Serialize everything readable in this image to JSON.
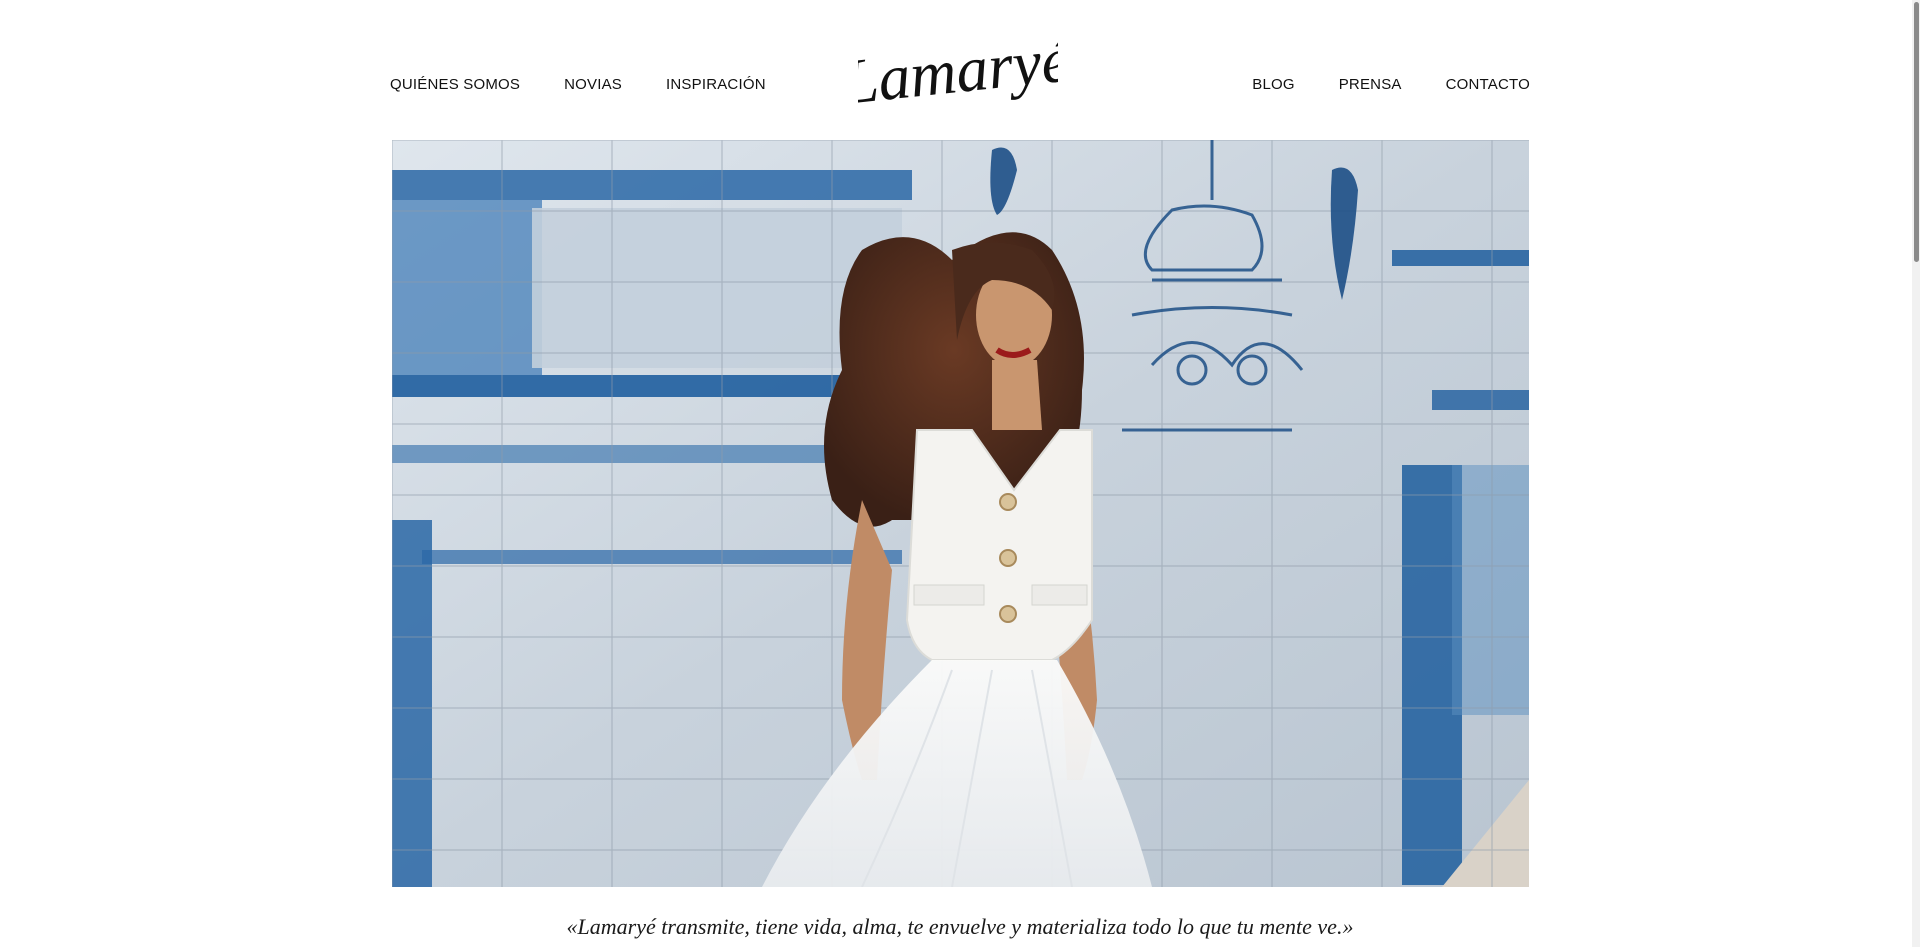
{
  "nav_left": [
    {
      "label": "QUIÉNES SOMOS"
    },
    {
      "label": "NOVIAS"
    },
    {
      "label": "INSPIRACIÓN"
    }
  ],
  "nav_right": [
    {
      "label": "BLOG"
    },
    {
      "label": "PRENSA"
    },
    {
      "label": "CONTACTO"
    }
  ],
  "logo": {
    "text": "Lamaryé"
  },
  "hero": {
    "colors": {
      "tile_light": "#d2dbe4",
      "tile_blue": "#1f5e9e",
      "dress": "#f7f7f5",
      "hair": "#4a2a1c"
    }
  },
  "quote": {
    "text": "«Lamaryé transmite, tiene vida, alma, te envuelve y materializa todo lo que tu mente ve.»"
  }
}
